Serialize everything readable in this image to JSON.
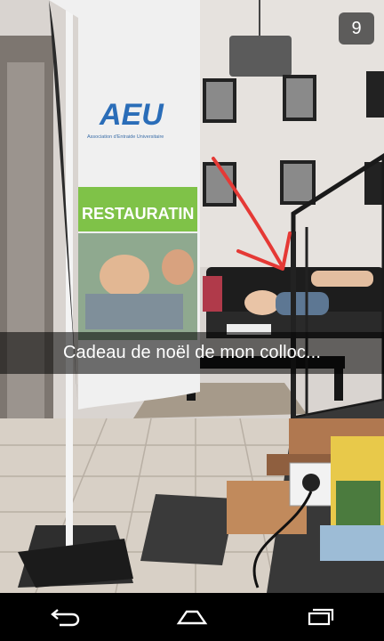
{
  "snap": {
    "timer": "9",
    "caption": "Cadeau de noël de mon colloc..."
  },
  "photo": {
    "banner_logo_text": "AEU",
    "banner_org_text": "Association d'Entraide Universitaire",
    "banner_strip_text": "RESTAURATIN",
    "annotation_color": "#e53935"
  },
  "navbar": {
    "icons": [
      "back-icon",
      "home-icon",
      "recent-apps-icon"
    ]
  }
}
